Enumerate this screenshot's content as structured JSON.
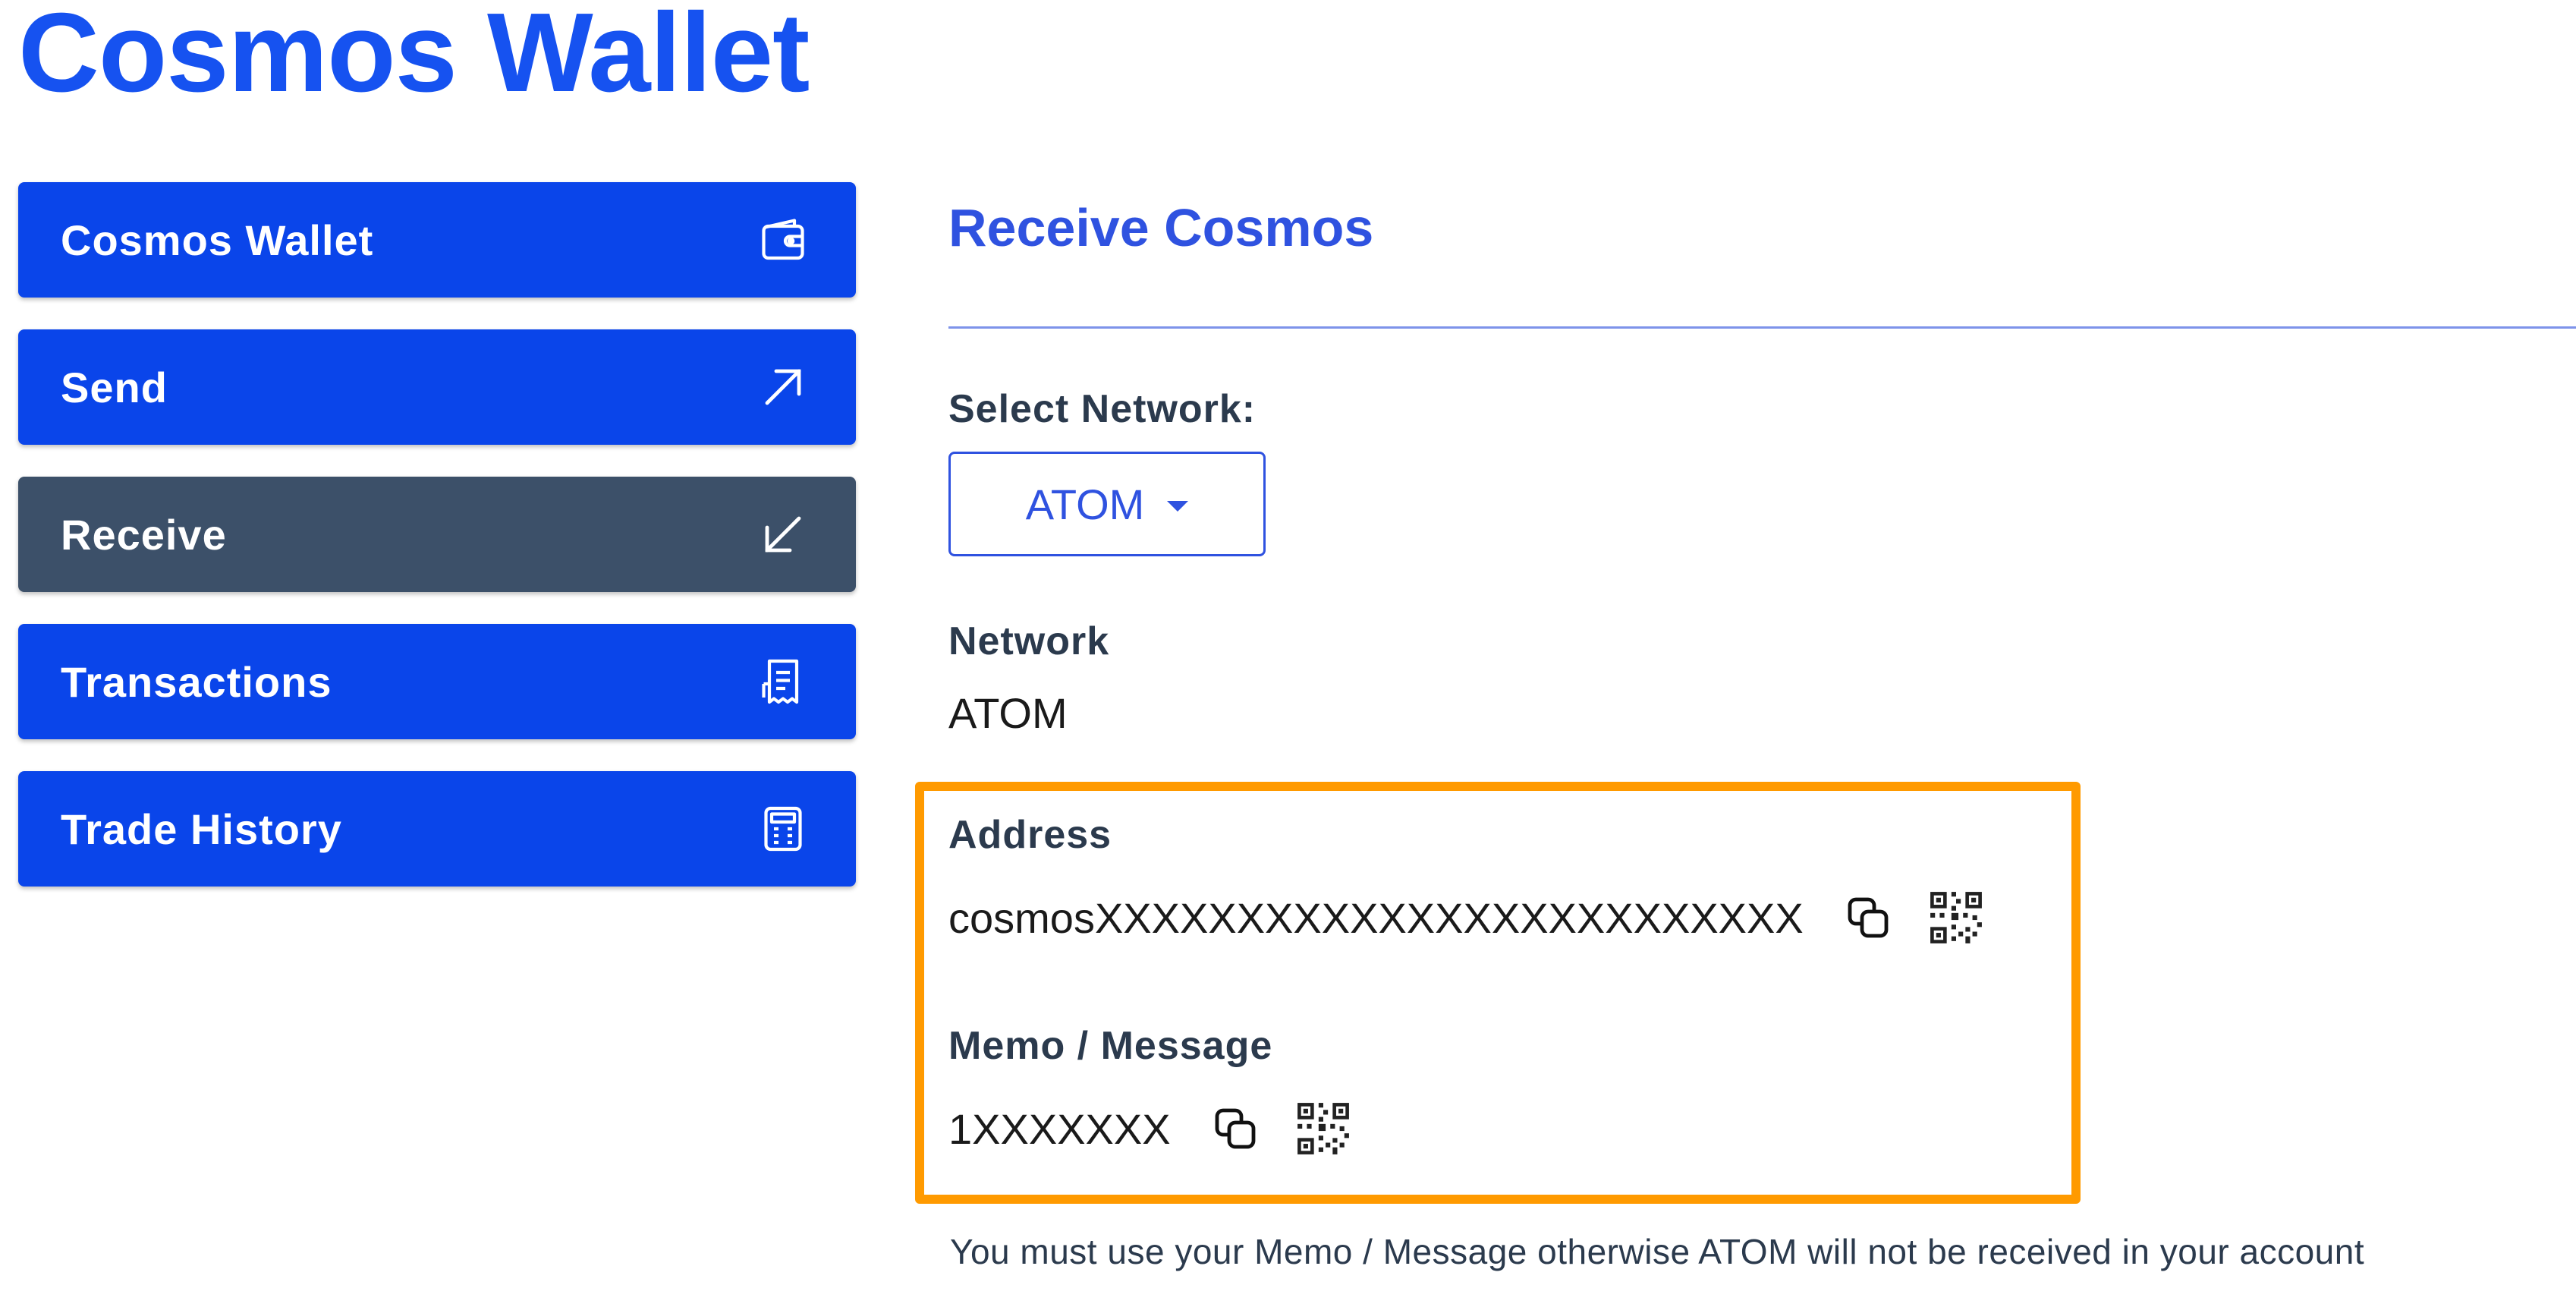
{
  "app": {
    "title": "Cosmos Wallet"
  },
  "sidebar": {
    "items": [
      {
        "label": "Cosmos Wallet",
        "icon": "wallet-icon",
        "active": false
      },
      {
        "label": "Send",
        "icon": "arrow-up-right-icon",
        "active": false
      },
      {
        "label": "Receive",
        "icon": "arrow-down-left-icon",
        "active": true
      },
      {
        "label": "Transactions",
        "icon": "receipt-icon",
        "active": false
      },
      {
        "label": "Trade History",
        "icon": "calculator-icon",
        "active": false
      }
    ]
  },
  "receive": {
    "title": "Receive Cosmos",
    "select_label": "Select Network:",
    "selected_network": "ATOM",
    "network_label": "Network",
    "network_value": "ATOM",
    "address_label": "Address",
    "address_value": "cosmosXXXXXXXXXXXXXXXXXXXXXXXXX",
    "memo_label": "Memo / Message",
    "memo_value": "1XXXXXXX",
    "warning": "You must use your Memo / Message otherwise ATOM will not be received in your account"
  },
  "colors": {
    "brand_blue": "#1652f0",
    "nav_blue": "#0a45ea",
    "nav_active": "#3c5069",
    "highlight": "#ff9a00"
  }
}
